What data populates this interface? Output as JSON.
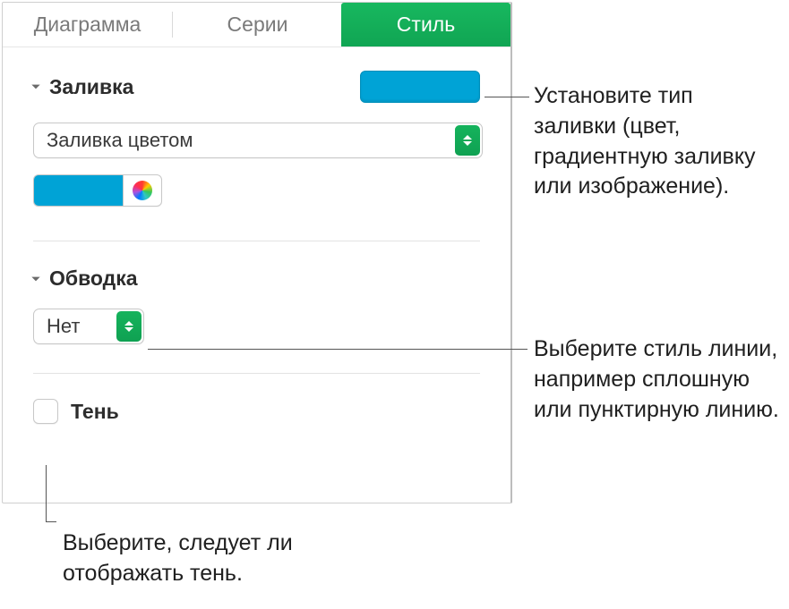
{
  "tabs": {
    "diagram": "Диаграмма",
    "series": "Серии",
    "style": "Стиль"
  },
  "fill": {
    "title": "Заливка",
    "dropdown": "Заливка цветом",
    "color": "#00a3d6"
  },
  "stroke": {
    "title": "Обводка",
    "dropdown": "Нет"
  },
  "shadow": {
    "label": "Тень"
  },
  "callouts": {
    "fill": "Установите тип заливки (цвет, градиентную заливку или изображение).",
    "stroke": "Выберите стиль линии, например сплошную или пунктирную линию.",
    "shadow": "Выберите, следует ли отображать тень."
  }
}
